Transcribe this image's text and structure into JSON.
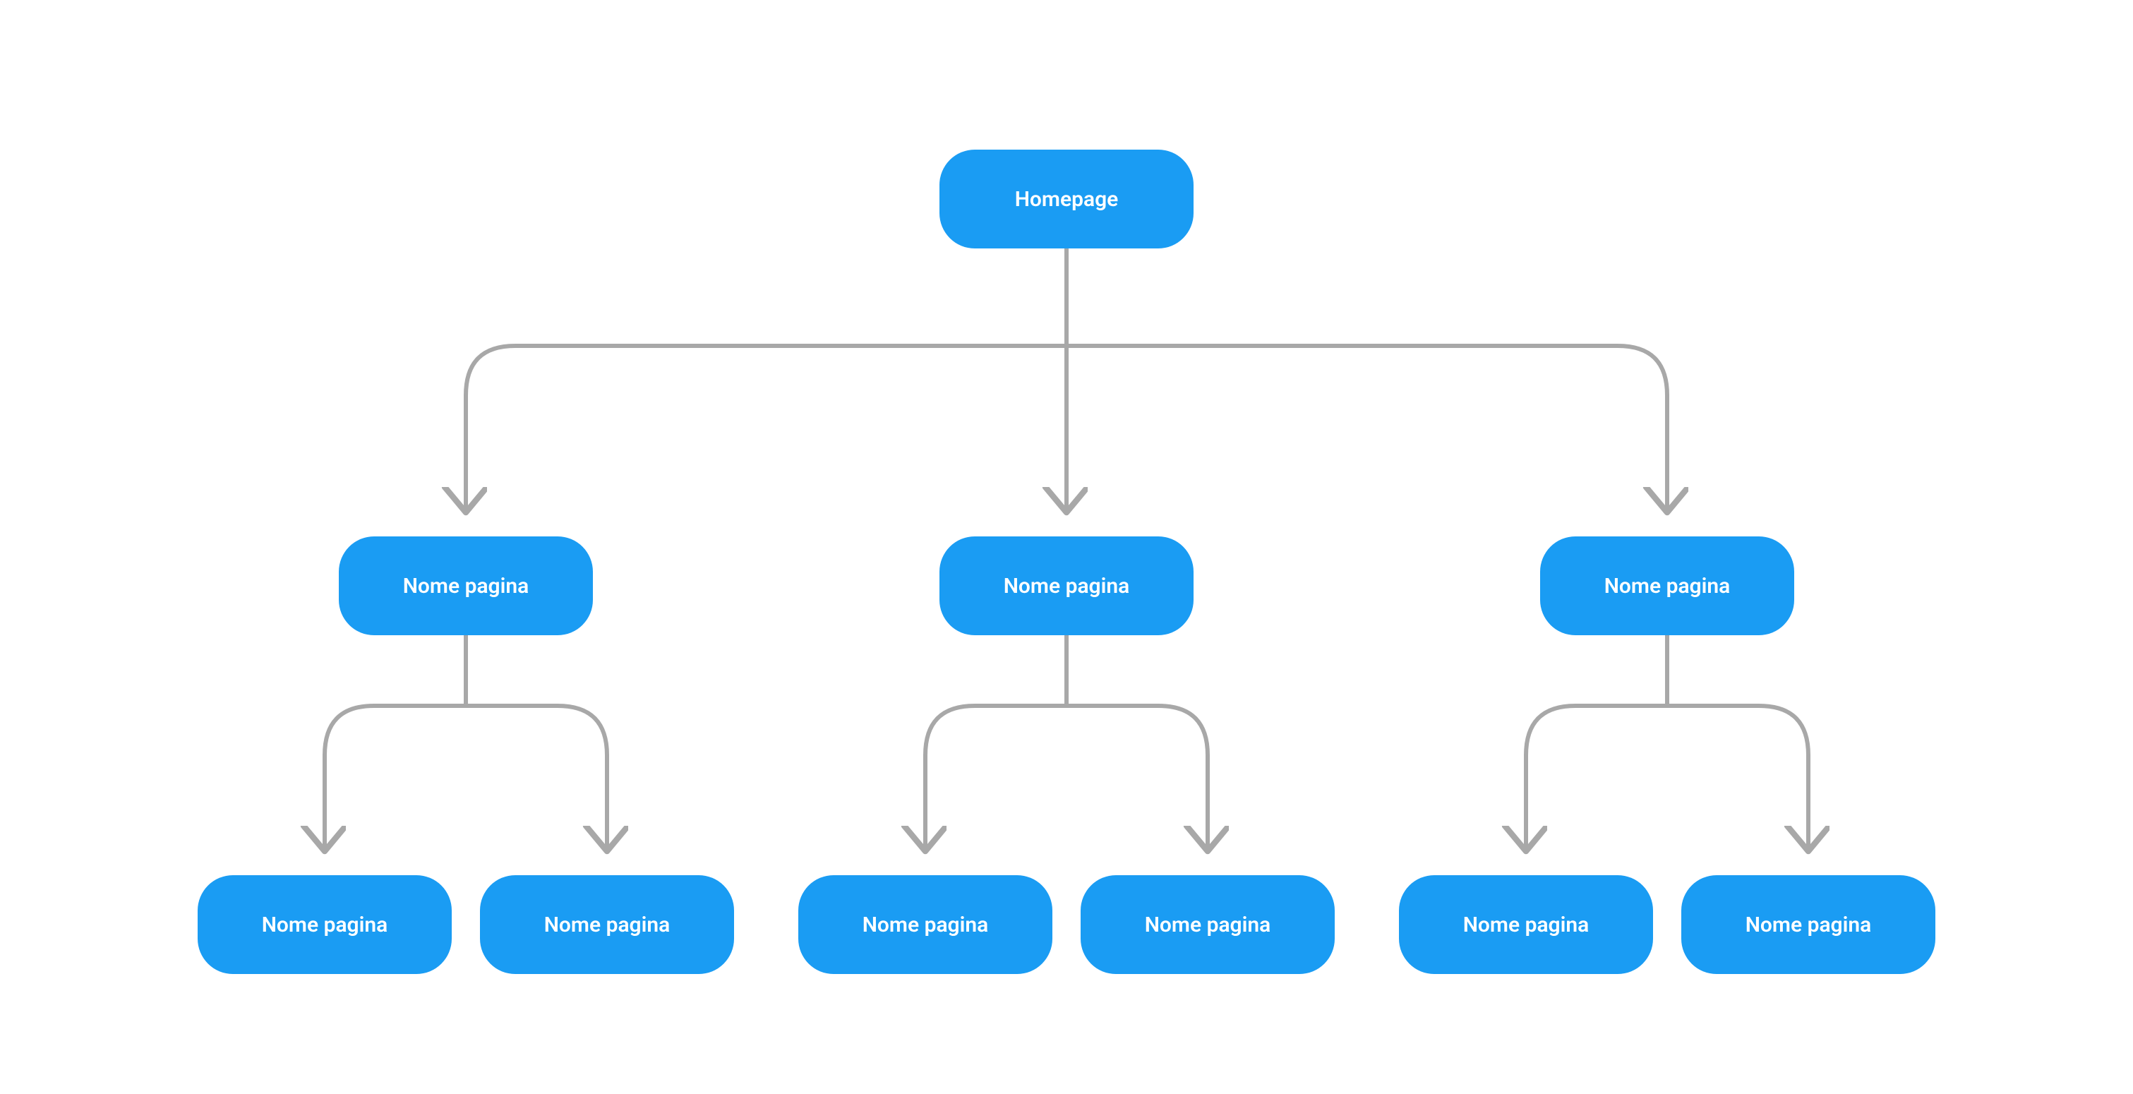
{
  "colors": {
    "node_fill": "#1a9cf3",
    "node_text": "#ffffff",
    "connector": "#a8a8a8"
  },
  "root": {
    "label": "Homepage"
  },
  "level1": [
    {
      "label": "Nome pagina"
    },
    {
      "label": "Nome pagina"
    },
    {
      "label": "Nome pagina"
    }
  ],
  "level2": [
    [
      {
        "label": "Nome pagina"
      },
      {
        "label": "Nome pagina"
      }
    ],
    [
      {
        "label": "Nome pagina"
      },
      {
        "label": "Nome pagina"
      }
    ],
    [
      {
        "label": "Nome pagina"
      },
      {
        "label": "Nome pagina"
      }
    ]
  ]
}
